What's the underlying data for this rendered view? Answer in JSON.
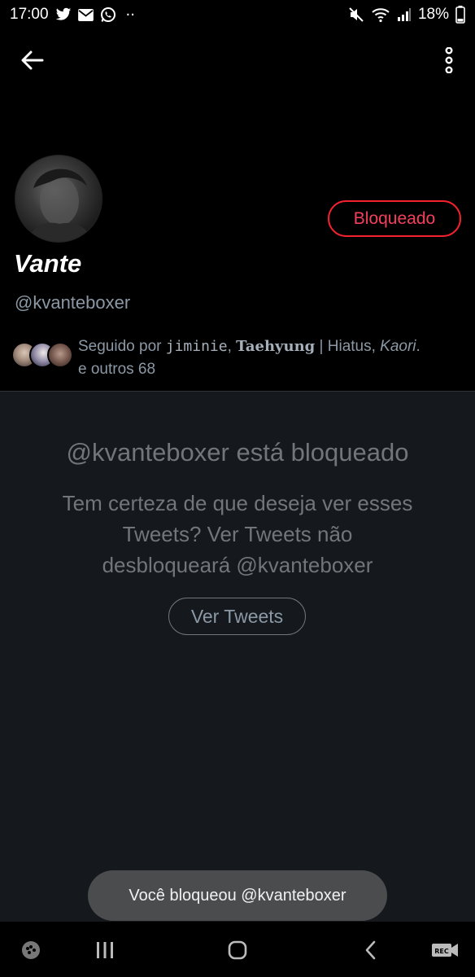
{
  "status_bar": {
    "time": "17:00",
    "dots": "··",
    "battery": "18%",
    "left_icons": [
      "twitter-icon",
      "mail-icon",
      "whatsapp-icon"
    ],
    "right_icons": [
      "mute-icon",
      "wifi-icon",
      "signal-icon",
      "battery-icon"
    ]
  },
  "top_bar": {
    "back_icon": "arrow-left-icon",
    "more_icon": "more-vertical-icon"
  },
  "profile": {
    "display_name": "Vante",
    "handle": "@kvanteboxer",
    "blocked_label": "Bloqueado",
    "followers": {
      "prefix": "Seguido por ",
      "name1": "jiminie",
      "sep1": ", ",
      "name2": "Taehyung",
      "name3": " | Hiatus, ",
      "name4": "Kaori",
      "end": ".",
      "line2": "e outros 68"
    }
  },
  "blocked_panel": {
    "title": "@kvanteboxer está bloqueado",
    "description": "Tem certeza de que deseja ver esses Tweets? Ver Tweets não desbloqueará @kvanteboxer",
    "view_button": "Ver Tweets"
  },
  "toast": {
    "text": "Você bloqueou @kvanteboxer"
  },
  "nav_bar": {
    "icons": [
      "game-launcher-icon",
      "recents-icon",
      "home-icon",
      "back-icon",
      "screen-recorder-icon"
    ],
    "rec_label": "REC"
  },
  "colors": {
    "background": "#000000",
    "panel": "#15181c",
    "blocked_red": "#f4212e",
    "muted_text": "#71767b"
  }
}
